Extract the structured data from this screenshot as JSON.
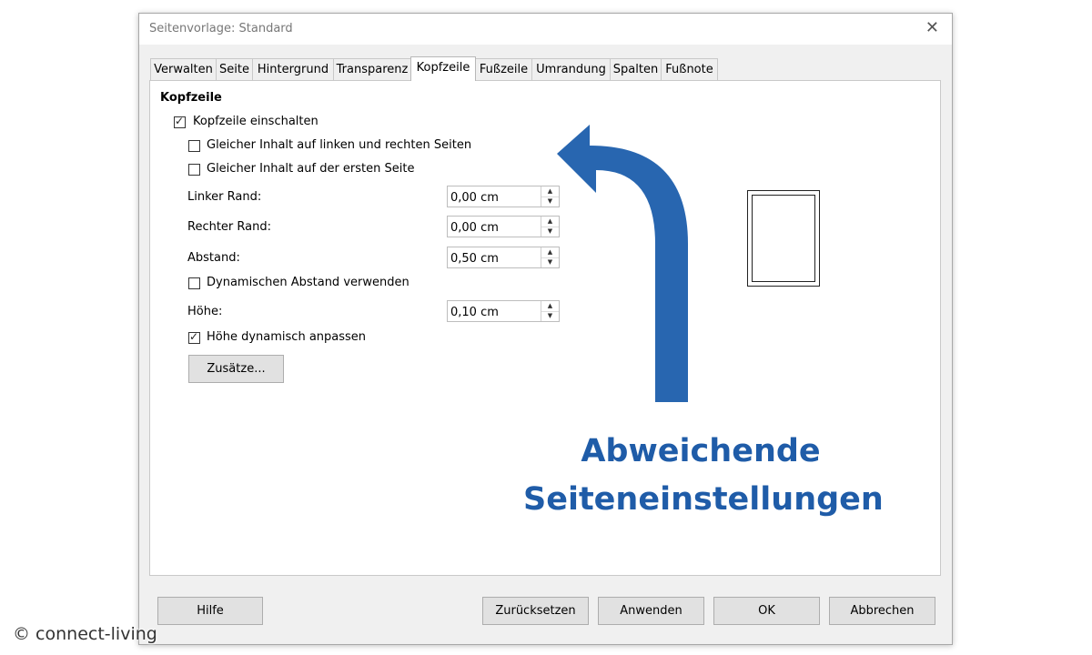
{
  "dialog": {
    "title": "Seitenvorlage: Standard",
    "close_glyph": "✕"
  },
  "tabs": [
    {
      "label": "Verwalten"
    },
    {
      "label": "Seite"
    },
    {
      "label": "Hintergrund"
    },
    {
      "label": "Transparenz"
    },
    {
      "label": "Kopfzeile",
      "active": true
    },
    {
      "label": "Fußzeile"
    },
    {
      "label": "Umrandung"
    },
    {
      "label": "Spalten"
    },
    {
      "label": "Fußnote"
    }
  ],
  "header_section": {
    "title": "Kopfzeile",
    "enable_header": {
      "label": "Kopfzeile einschalten",
      "checked": true
    },
    "same_left_right": {
      "label": "Gleicher Inhalt auf linken und rechten Seiten",
      "checked": false
    },
    "same_first_page": {
      "label": "Gleicher Inhalt auf der ersten Seite",
      "checked": false
    },
    "left_margin": {
      "label": "Linker Rand:",
      "value": "0,00 cm"
    },
    "right_margin": {
      "label": "Rechter Rand:",
      "value": "0,00 cm"
    },
    "spacing": {
      "label": "Abstand:",
      "value": "0,50 cm"
    },
    "dynamic_spacing": {
      "label": "Dynamischen Abstand verwenden",
      "checked": false
    },
    "height": {
      "label": "Höhe:",
      "value": "0,10 cm"
    },
    "autofit_height": {
      "label": "Höhe dynamisch anpassen",
      "checked": true
    },
    "more_button": "Zusätze..."
  },
  "footer_buttons": {
    "help": "Hilfe",
    "reset": "Zurücksetzen",
    "apply": "Anwenden",
    "ok": "OK",
    "cancel": "Abbrechen"
  },
  "annotation": {
    "line1": "Abweichende",
    "line2": "Seiteneinstellungen",
    "color": "#1f5ca8"
  },
  "watermark": "© connect-living"
}
